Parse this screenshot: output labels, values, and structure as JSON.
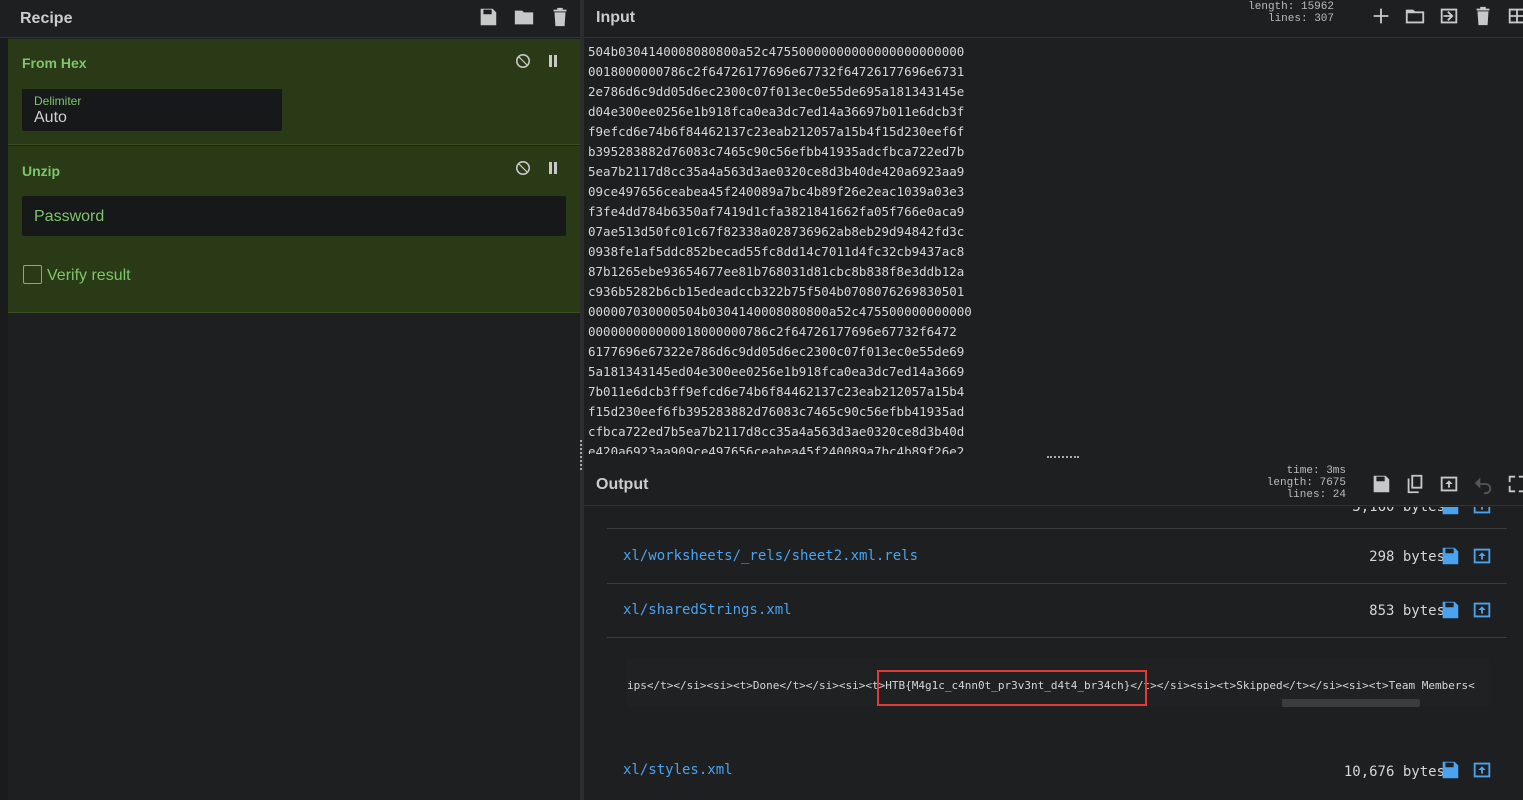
{
  "recipe": {
    "title": "Recipe",
    "operations": [
      {
        "name": "From Hex",
        "field_label": "Delimiter",
        "field_value": "Auto"
      },
      {
        "name": "Unzip",
        "password_placeholder": "Password",
        "verify_label": "Verify result",
        "verify_checked": false
      }
    ]
  },
  "input": {
    "title": "Input",
    "stats": {
      "length_label": "length:",
      "length": "15962",
      "lines_label": "lines:",
      "lines": "307"
    },
    "lines": [
      "504b0304140008080800a52c47550000000000000000000000",
      "0018000000786c2f64726177696e67732f64726177696e6731",
      "2e786d6c9dd05d6ec2300c07f013ec0e55de695a181343145e",
      "d04e300ee0256e1b918fca0ea3dc7ed14a36697b011e6dcb3f",
      "f9efcd6e74b6f84462137c23eab212057a15b4f15d230eef6f",
      "b395283882d76083c7465c90c56efbb41935adcfbca722ed7b",
      "5ea7b2117d8cc35a4a563d3ae0320ce8d3b40de420a6923aa9",
      "09ce497656ceabea45f240089a7bc4b89f26e2eac1039a03e3",
      "f3fe4dd784b6350af7419d1cfa3821841662fa05f766e0aca9",
      "07ae513d50fc01c67f82338a028736962ab8eb29d94842fd3c",
      "0938fe1af5ddc852becad55fc8dd14c7011d4fc32cb9437ac8",
      "87b1265ebe93654677ee81b768031d81cbc8b838f8e3ddb12a",
      "c936b5282b6cb15edeadccb322b75f504b0708076269830501",
      "000007030000504b0304140008080800a52c475500000000000",
      "000000000000018000000786c2f64726177696e67732f6472",
      "6177696e67322e786d6c9dd05d6ec2300c07f013ec0e55de69",
      "5a181343145ed04e300ee0256e1b918fca0ea3dc7ed14a3669",
      "7b011e6dcb3ff9efcd6e74b6f84462137c23eab212057a15b4",
      "f15d230eef6fb395283882d76083c7465c90c56efbb41935ad",
      "cfbca722ed7b5ea7b2117d8cc35a4a563d3ae0320ce8d3b40d",
      "e420a6923aa909ce497656ceabea45f240089a7bc4b89f26e2"
    ]
  },
  "output": {
    "title": "Output",
    "stats": {
      "time_label": "time:",
      "time": "3ms",
      "length_label": "length:",
      "length": "7675",
      "lines_label": "lines:",
      "lines": "24"
    },
    "partial_size": "3,160 bytes",
    "files": [
      {
        "name": "xl/worksheets/_rels/sheet2.xml.rels",
        "size": "298 bytes"
      },
      {
        "name": "xl/sharedStrings.xml",
        "size": "853 bytes"
      },
      {
        "name": "xl/styles.xml",
        "size": "10,676 bytes"
      }
    ],
    "preview_text": "ips</t></si><si><t>Done</t></si><si><t>HTB{M4g1c_c4nn0t_pr3v3nt_d4t4_br34ch}</t></si><si><t>Skipped</t></si><si><t>Team Members<"
  },
  "colors": {
    "accent": "#7fc56e",
    "op_bg": "#2a3a17",
    "link": "#4aa3f0",
    "highlight": "#e53935"
  }
}
